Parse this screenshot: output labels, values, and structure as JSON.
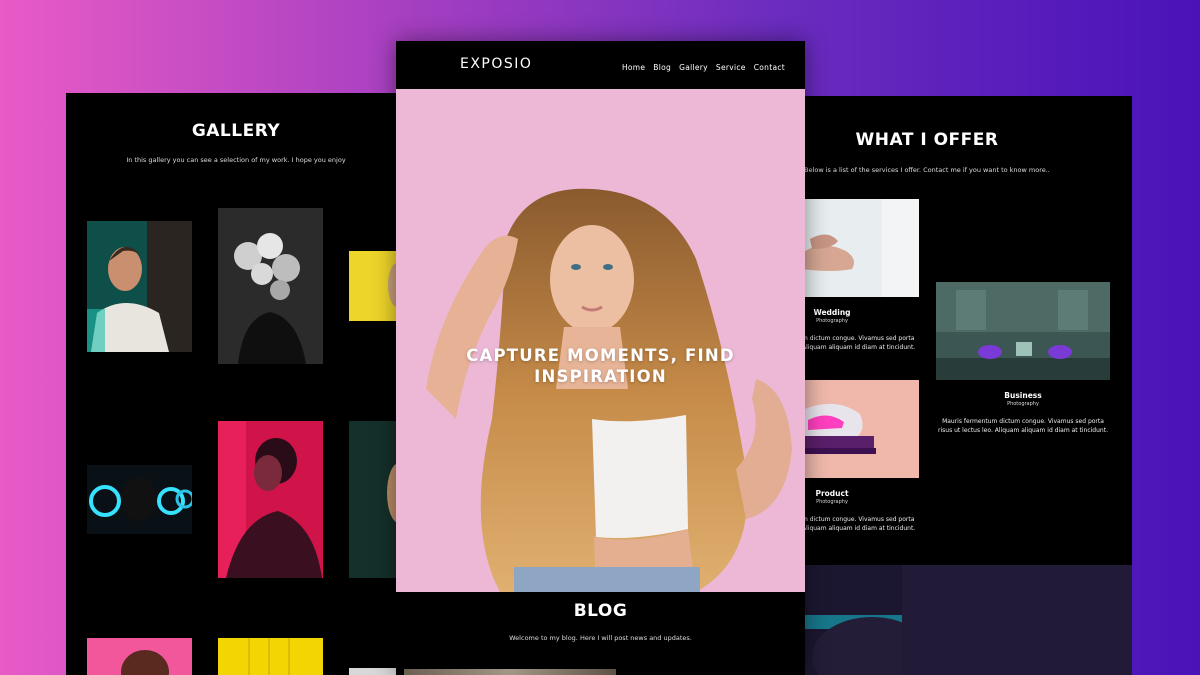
{
  "gallery": {
    "title": "GALLERY",
    "subtitle": "In this gallery you can see a selection of my work. I hope you enjoy"
  },
  "site": {
    "logo": "EXPOSIO",
    "nav": [
      "Home",
      "Blog",
      "Gallery",
      "Service",
      "Contact"
    ],
    "hero_line1": "CAPTURE MOMENTS, FIND",
    "hero_line2": "INSPIRATION",
    "blog_title": "BLOG",
    "blog_subtitle": "Welcome to my blog. Here I will post news and updates."
  },
  "offer": {
    "title": "WHAT I OFFER",
    "subtitle": "Below is a list of the services I offer. Contact me if you want to know more..",
    "services": [
      {
        "name": "Wedding",
        "category": "Photography",
        "desc1": "m dictum congue. Vivamus sed porta",
        "desc2": "Aliquam aliquam id diam at tincidunt."
      },
      {
        "name": "Business",
        "category": "Photography",
        "desc1": "Mauris fermentum dictum congue. Vivamus sed porta",
        "desc2": "risus ut lectus leo. Aliquam aliquam id diam at tincidunt."
      },
      {
        "name": "Product",
        "category": "Photography",
        "desc1": "m dictum congue. Vivamus sed porta",
        "desc2": "Aliquam aliquam id diam at tincidunt."
      }
    ]
  }
}
